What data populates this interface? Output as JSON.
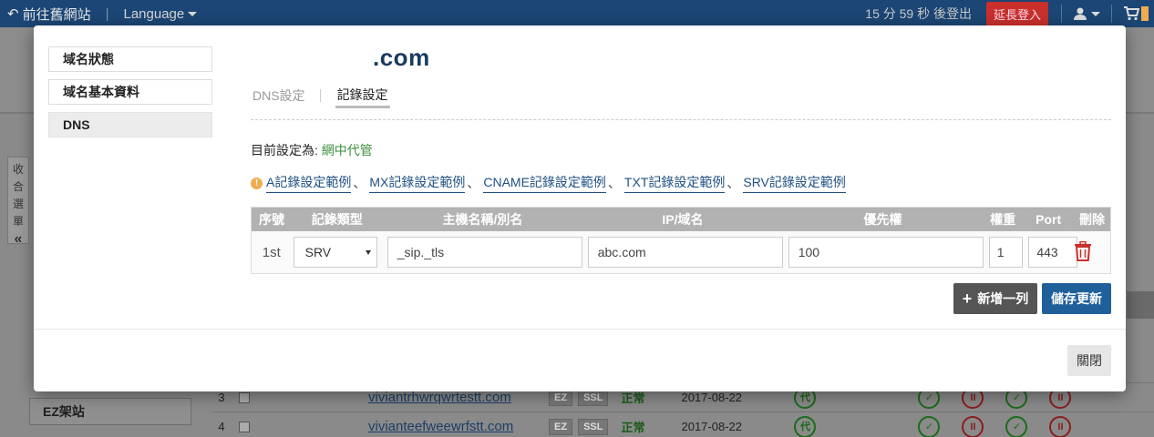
{
  "topbar": {
    "back_label": "前往舊網站",
    "language_label": "Language",
    "logout_timer": "15 分 59 秒 後登出",
    "extend_label": "延長登入"
  },
  "background": {
    "collapse_label": "收合選單",
    "collapse_arrow": "«",
    "side_item": "EZ架站",
    "rows": [
      {
        "num": "3",
        "domain": "viviantrhwrqwrtestt.com",
        "tags": [
          "EZ",
          "SSL"
        ],
        "status": "正常",
        "date": "2017-08-22",
        "badge": "代"
      },
      {
        "num": "4",
        "domain": "vivianteefweewrfstt.com",
        "tags": [
          "EZ",
          "SSL"
        ],
        "status": "正常",
        "date": "2017-08-22",
        "badge": "代"
      }
    ]
  },
  "modal": {
    "sidebar": {
      "items": [
        {
          "label": "域名狀態"
        },
        {
          "label": "域名基本資料"
        },
        {
          "label": "DNS"
        }
      ]
    },
    "domain_title": ".com",
    "tabs": [
      {
        "label": "DNS設定"
      },
      {
        "label": "記錄設定"
      }
    ],
    "current": {
      "prefix": "目前設定為: ",
      "value": "網中代管"
    },
    "examples": [
      {
        "label": "A記錄設定範例"
      },
      {
        "label": "MX記錄設定範例"
      },
      {
        "label": "CNAME記錄設定範例"
      },
      {
        "label": "TXT記錄設定範例"
      },
      {
        "label": "SRV記錄設定範例"
      }
    ],
    "example_sep": "、",
    "table": {
      "headers": [
        "序號",
        "記錄類型",
        "主機名稱/別名",
        "IP/域名",
        "優先權",
        "權重",
        "Port",
        "刪除"
      ],
      "row": {
        "seq": "1st",
        "type": "SRV",
        "host": "_sip._tls",
        "ip": "abc.com",
        "priority": "100",
        "weight": "1",
        "port": "443"
      }
    },
    "buttons": {
      "add_row": "新增一列",
      "save": "儲存更新",
      "close": "關閉"
    }
  },
  "colors": {
    "topbar_bg": "#1b4675",
    "accent_blue": "#1f5f9a",
    "status_green": "#3c8f3c",
    "delete_red": "#c9302c"
  }
}
